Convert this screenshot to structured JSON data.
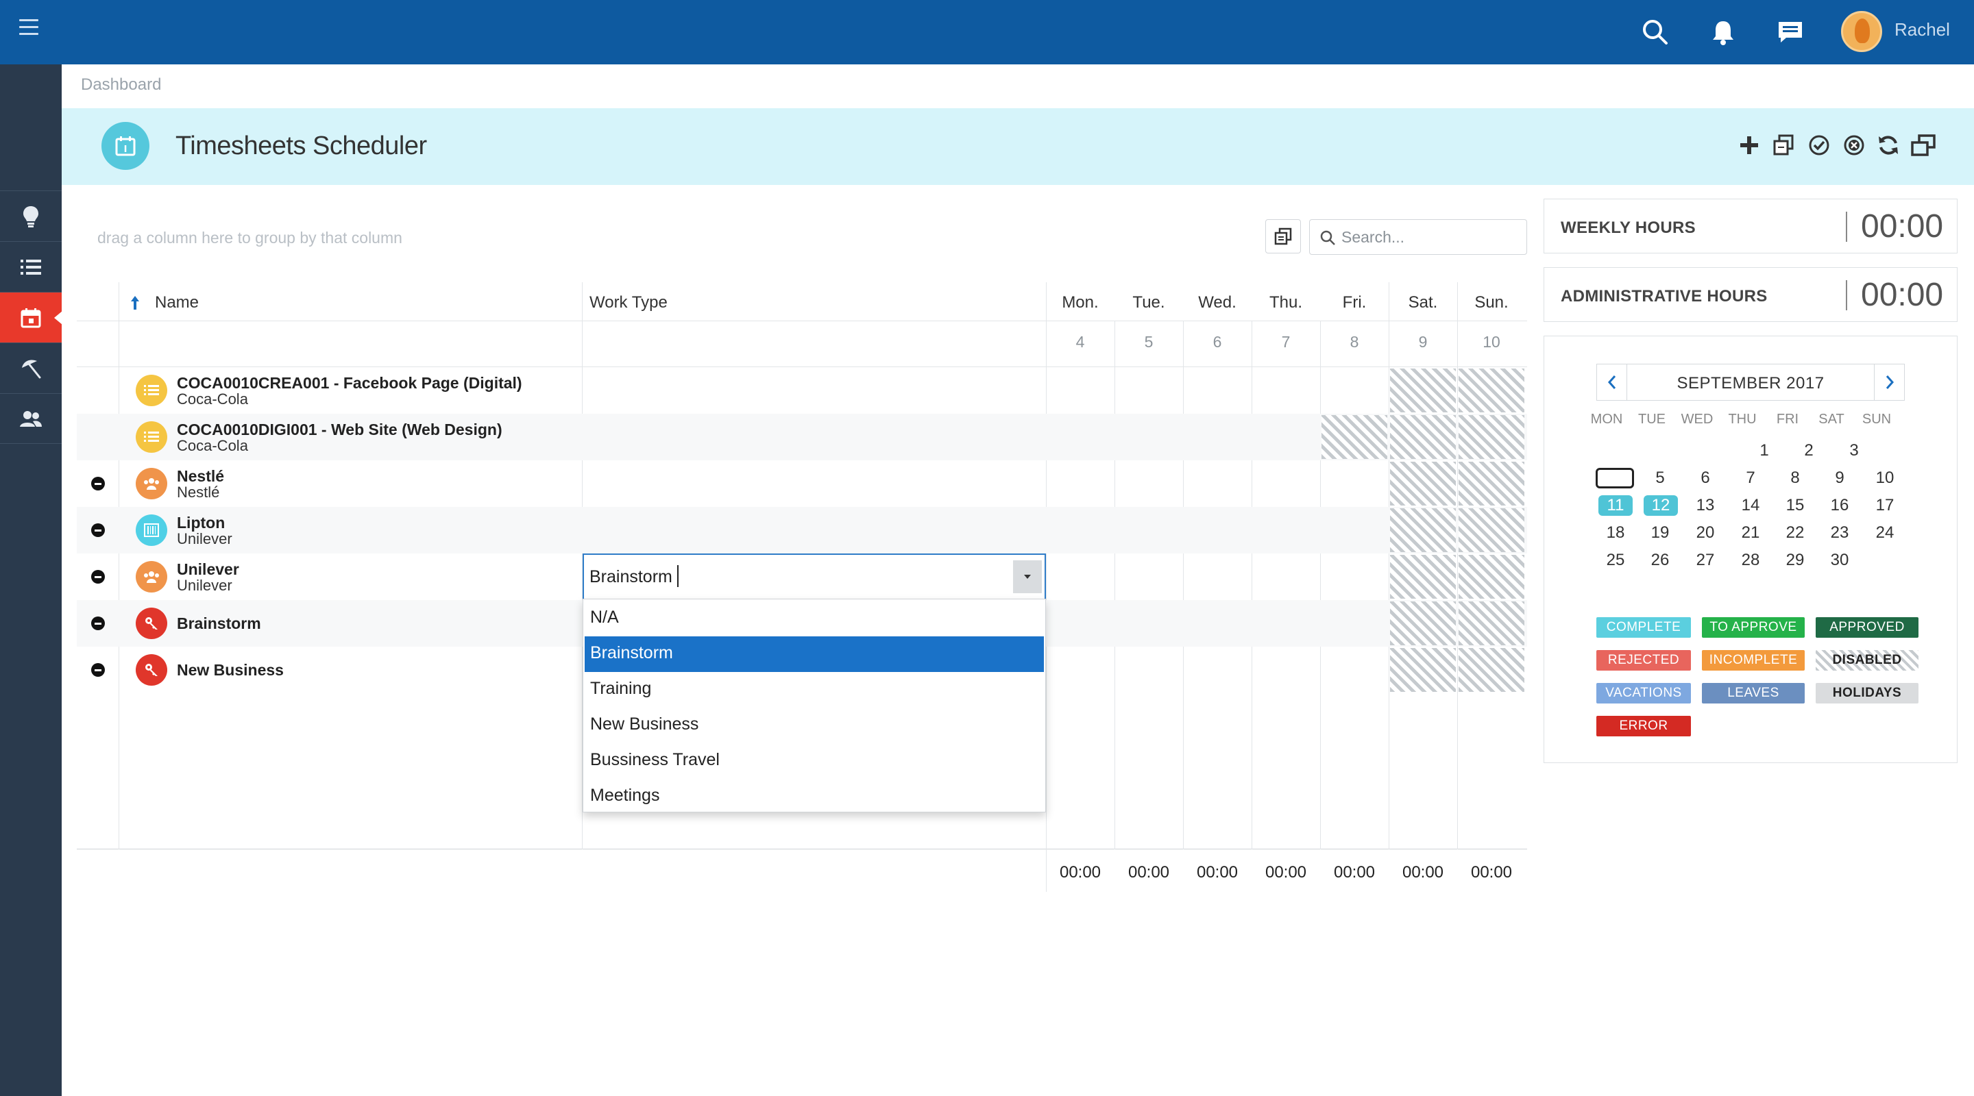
{
  "header": {
    "user_name": "Rachel"
  },
  "breadcrumb": "Dashboard",
  "page": {
    "title": "Timesheets Scheduler"
  },
  "grid": {
    "group_hint": "drag a column here to group by that column",
    "search_placeholder": "Search...",
    "columns": {
      "name": "Name",
      "work_type": "Work Type"
    },
    "days": [
      {
        "name": "Mon.",
        "num": "4"
      },
      {
        "name": "Tue.",
        "num": "5"
      },
      {
        "name": "Wed.",
        "num": "6"
      },
      {
        "name": "Thu.",
        "num": "7"
      },
      {
        "name": "Fri.",
        "num": "8"
      },
      {
        "name": "Sat.",
        "num": "9"
      },
      {
        "name": "Sun.",
        "num": "10"
      }
    ],
    "rows": [
      {
        "title": "COCA0010CREA001 - Facebook Page (Digital)",
        "subtitle": "Coca-Cola",
        "icon": "list-icon",
        "icon_color": "#f5c542"
      },
      {
        "title": "COCA0010DIGI001 - Web Site (Web Design)",
        "subtitle": "Coca-Cola",
        "icon": "list-icon",
        "icon_color": "#f5c542"
      },
      {
        "title": "Nestlé",
        "subtitle": "Nestlé",
        "icon": "people-icon",
        "icon_color": "#f0944a"
      },
      {
        "title": "Lipton",
        "subtitle": "Unilever",
        "icon": "barcode-icon",
        "icon_color": "#4fd0e6"
      },
      {
        "title": "Unilever",
        "subtitle": "Unilever",
        "icon": "people-icon",
        "icon_color": "#f0944a"
      },
      {
        "title": "Brainstorm",
        "subtitle": "",
        "icon": "key-icon",
        "icon_color": "#e0362b"
      },
      {
        "title": "New Business",
        "subtitle": "",
        "icon": "key-icon",
        "icon_color": "#e0362b"
      }
    ],
    "work_type_value": "Brainstorm",
    "work_type_options": [
      "N/A",
      "Brainstorm",
      "Training",
      "New Business",
      "Bussiness Travel",
      "Meetings"
    ],
    "totals": [
      "00:00",
      "00:00",
      "00:00",
      "00:00",
      "00:00",
      "00:00",
      "00:00"
    ]
  },
  "hours": {
    "weekly_label": "WEEKLY HOURS",
    "weekly_value": "00:00",
    "admin_label": "ADMINISTRATIVE HOURS",
    "admin_value": "00:00"
  },
  "calendar": {
    "title": "SEPTEMBER 2017",
    "weekdays": [
      "MON",
      "TUE",
      "WED",
      "THU",
      "FRI",
      "SAT",
      "SUN"
    ],
    "weeks": [
      [
        "",
        "",
        "",
        "",
        "1",
        "2",
        "3"
      ],
      [
        "",
        "5",
        "6",
        "7",
        "8",
        "9",
        "10"
      ],
      [
        "11",
        "12",
        "13",
        "14",
        "15",
        "16",
        "17"
      ],
      [
        "18",
        "19",
        "20",
        "21",
        "22",
        "23",
        "24"
      ],
      [
        "25",
        "26",
        "27",
        "28",
        "29",
        "30",
        ""
      ]
    ]
  },
  "legend": {
    "complete": "COMPLETE",
    "to_approve": "TO APPROVE",
    "approved": "APPROVED",
    "rejected": "REJECTED",
    "incomplete": "INCOMPLETE",
    "disabled": "DISABLED",
    "vacations": "VACATIONS",
    "leaves": "LEAVES",
    "holidays": "HOLIDAYS",
    "error": "ERROR"
  },
  "colors": {
    "topbar": "#0e5aa0",
    "sidebar": "#2a3a4d",
    "sidebar_active": "#e8392b",
    "titlebar": "#d6f4fa",
    "selection": "#1a72c8"
  }
}
